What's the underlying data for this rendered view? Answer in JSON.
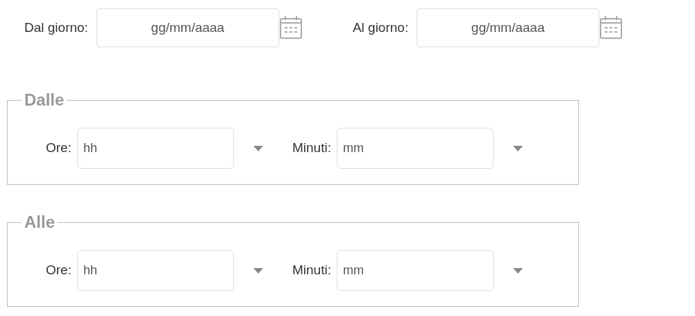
{
  "date_fields": [
    {
      "label": "Dal giorno:",
      "placeholder": "gg/mm/aaaa"
    },
    {
      "label": "Al giorno:",
      "placeholder": "gg/mm/aaaa"
    }
  ],
  "time_groups": [
    {
      "legend": "Dalle",
      "fields": [
        {
          "label": "Ore:",
          "placeholder": "hh"
        },
        {
          "label": "Minuti:",
          "placeholder": "mm"
        }
      ]
    },
    {
      "legend": "Alle",
      "fields": [
        {
          "label": "Ore:",
          "placeholder": "hh"
        },
        {
          "label": "Minuti:",
          "placeholder": "mm"
        }
      ]
    }
  ]
}
